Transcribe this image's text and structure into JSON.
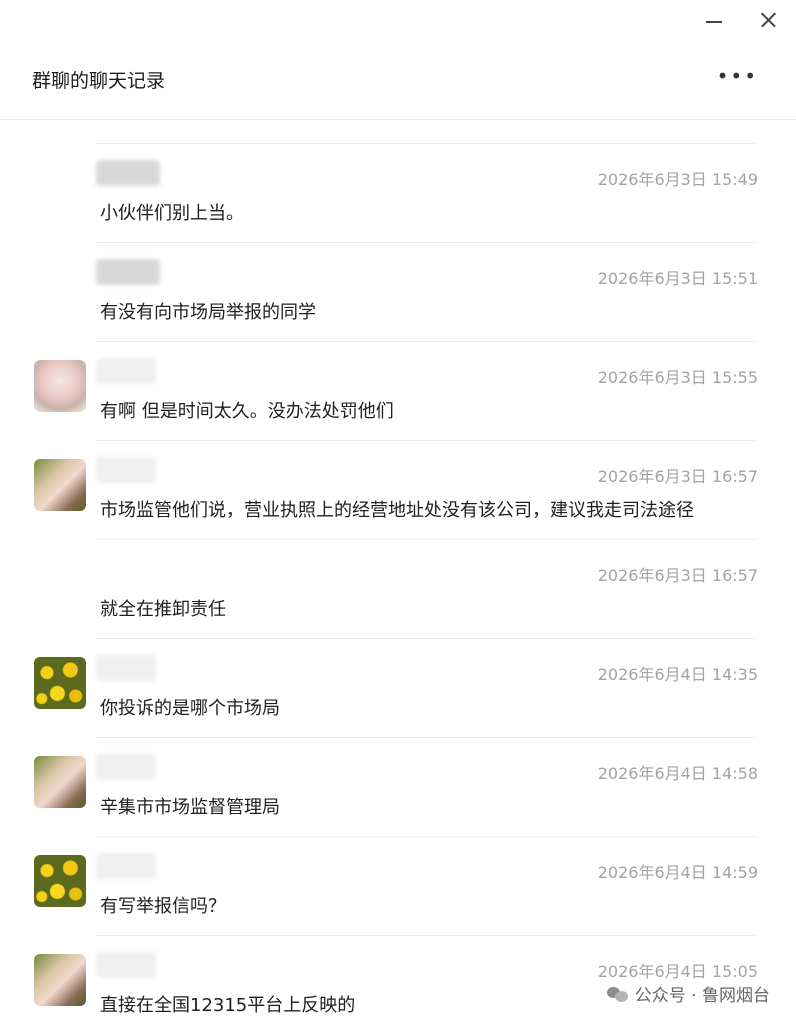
{
  "window": {
    "title": "群聊的聊天记录",
    "more_label": "•••"
  },
  "messages": [
    {
      "avatar": "none",
      "name_hidden": true,
      "time": "2026年6月3日 15:49",
      "text": "小伙伴们别上当。"
    },
    {
      "avatar": "none",
      "name_hidden": true,
      "time": "2026年6月3日 15:51",
      "text": "有没有向市场局举报的同学"
    },
    {
      "avatar": "girl-sketch-avatar",
      "name_hidden": true,
      "time": "2026年6月3日 15:55",
      "text": "有啊   但是时间太久。没办法处罚他们"
    },
    {
      "avatar": "girl-photo-avatar",
      "name_hidden": true,
      "time": "2026年6月3日 16:57",
      "text": "市场监管他们说，营业执照上的经营地址处没有该公司，建议我走司法途径"
    },
    {
      "avatar": "none",
      "name_hidden": false,
      "time": "2026年6月3日 16:57",
      "text": "就全在推卸责任"
    },
    {
      "avatar": "flowers-avatar",
      "name_hidden": true,
      "time": "2026年6月4日 14:35",
      "text": "你投诉的是哪个市场局"
    },
    {
      "avatar": "girl-photo-avatar",
      "name_hidden": true,
      "time": "2026年6月4日 14:58",
      "text": "辛集市市场监督管理局"
    },
    {
      "avatar": "flowers-avatar",
      "name_hidden": true,
      "time": "2026年6月4日 14:59",
      "text": "有写举报信吗？"
    },
    {
      "avatar": "girl-photo-avatar",
      "name_hidden": true,
      "time": "2026年6月4日 15:05",
      "text": "直接在全国12315平台上反映的"
    }
  ],
  "watermark": {
    "text": "公众号 · 鲁网烟台"
  }
}
